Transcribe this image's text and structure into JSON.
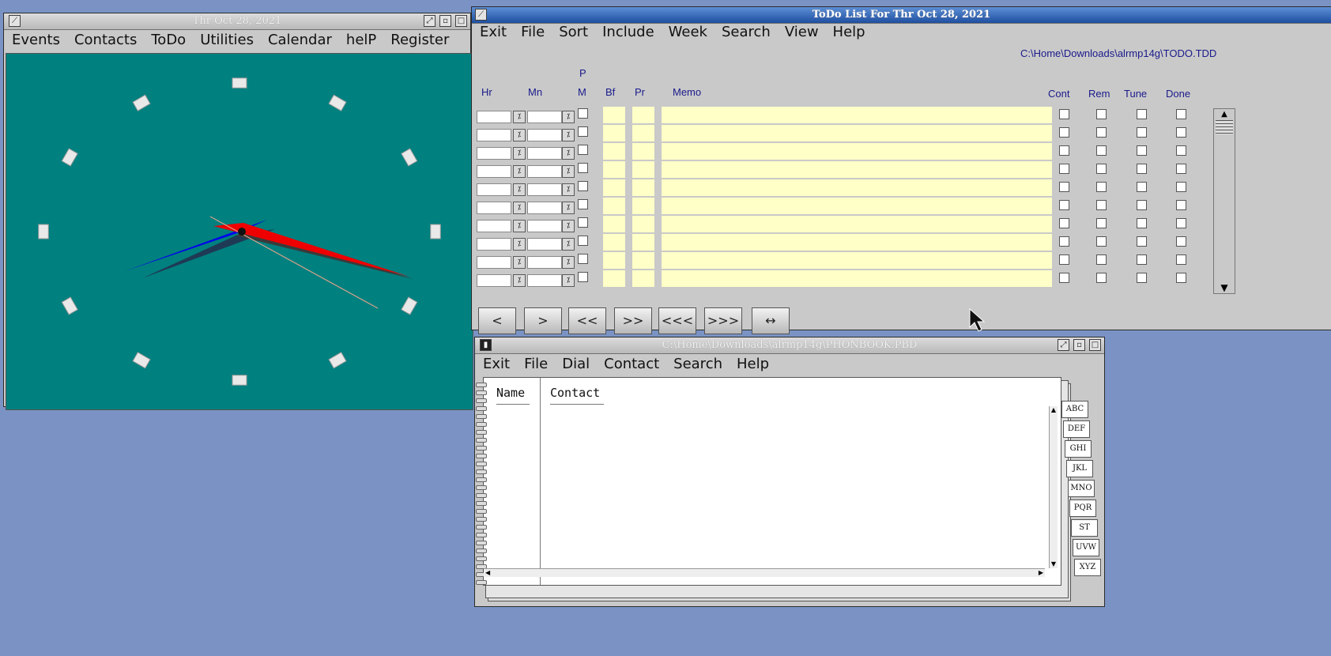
{
  "clock_window": {
    "title": "Thr Oct 28, 2021",
    "menu": [
      {
        "label": "Events"
      },
      {
        "label": "Contacts"
      },
      {
        "label": "ToDo"
      },
      {
        "label": "Utilities"
      },
      {
        "label": "Calendar"
      },
      {
        "label": "helP"
      },
      {
        "label": "Register"
      }
    ],
    "colors": {
      "face": "#00807f",
      "hour_hand": "#0000ff",
      "minute_hand": "#ff0000",
      "second_hand": "#d9a28a"
    }
  },
  "todo_window": {
    "title": "ToDo List For Thr Oct 28, 2021",
    "menu": [
      {
        "label": "Exit"
      },
      {
        "label": "File"
      },
      {
        "label": "Sort"
      },
      {
        "label": "Include"
      },
      {
        "label": "Week"
      },
      {
        "label": "Search"
      },
      {
        "label": "View"
      },
      {
        "label": "Help"
      }
    ],
    "file_path": "C:\\Home\\Downloads\\alrmp14g\\TODO.TDD",
    "columns": {
      "hr": "Hr",
      "mn": "Mn",
      "pm_top": "P",
      "pm_bottom": "M",
      "bf": "Bf",
      "pr": "Pr",
      "memo": "Memo",
      "cont": "Cont",
      "rem": "Rem",
      "tune": "Tune",
      "done": "Done"
    },
    "row_count": 10,
    "nav_buttons": [
      {
        "label": "<"
      },
      {
        "label": ">"
      },
      {
        "label": "<<"
      },
      {
        "label": ">>"
      },
      {
        "label": "<<<"
      },
      {
        "label": ">>>"
      },
      {
        "label": "↔"
      }
    ]
  },
  "phonebook_window": {
    "title": "C:\\Home\\Downloads\\alrmp14g\\PHONBOOK.PBD",
    "menu": [
      {
        "label": "Exit"
      },
      {
        "label": "File"
      },
      {
        "label": "Dial"
      },
      {
        "label": "Contact"
      },
      {
        "label": "Search"
      },
      {
        "label": "Help"
      }
    ],
    "columns": {
      "name": "Name",
      "contact": "Contact"
    },
    "tabs": [
      {
        "label": "ABC"
      },
      {
        "label": "DEF"
      },
      {
        "label": "GHI"
      },
      {
        "label": "JKL"
      },
      {
        "label": "MNO"
      },
      {
        "label": "PQR"
      },
      {
        "label": "ST"
      },
      {
        "label": "UVW"
      },
      {
        "label": "XYZ"
      }
    ]
  }
}
